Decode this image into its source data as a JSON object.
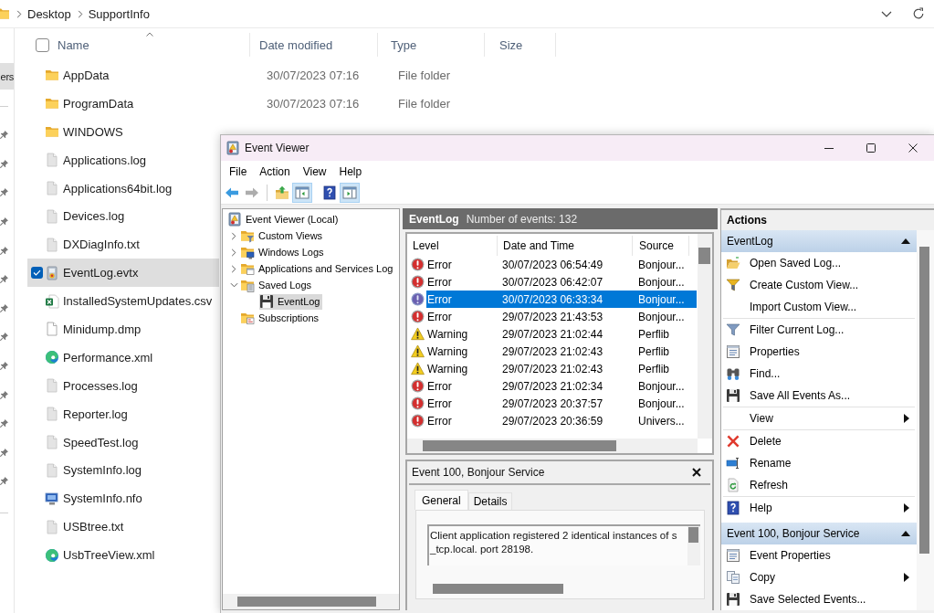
{
  "explorer": {
    "breadcrumb": [
      {
        "label": "Desktop"
      },
      {
        "label": "SupportInfo"
      }
    ],
    "nav_pane": {
      "groups": [
        {
          "items": [
            {
              "label": "ers",
              "selected": true,
              "pinned": false
            }
          ]
        },
        {
          "items": [
            {
              "pinned": true,
              "selected": false
            },
            {
              "pinned": true,
              "selected": false
            },
            {
              "pinned": true,
              "selected": false
            },
            {
              "pinned": true,
              "selected": false
            },
            {
              "pinned": true,
              "selected": false
            },
            {
              "pinned": true,
              "selected": false
            },
            {
              "pinned": true,
              "selected": false
            },
            {
              "pinned": true,
              "selected": false
            },
            {
              "pinned": true,
              "selected": false
            },
            {
              "pinned": true,
              "selected": false
            },
            {
              "pinned": true,
              "selected": false
            },
            {
              "pinned": true,
              "selected": false
            },
            {
              "pinned": true,
              "selected": false
            }
          ]
        }
      ]
    },
    "select_all": {
      "checked": false
    },
    "columns": [
      {
        "label": "Name",
        "sorted": true
      },
      {
        "label": "Date modified",
        "sorted": false
      },
      {
        "label": "Type",
        "sorted": false
      },
      {
        "label": "Size",
        "sorted": false
      }
    ],
    "files": [
      {
        "name": "AppData",
        "kind": "folder",
        "date": "30/07/2023 07:16",
        "type": "File folder",
        "selected": false
      },
      {
        "name": "ProgramData",
        "kind": "folder",
        "date": "30/07/2023 07:16",
        "type": "File folder",
        "selected": false
      },
      {
        "name": "WINDOWS",
        "kind": "folder",
        "selected": false
      },
      {
        "name": "Applications.log",
        "kind": "document",
        "selected": false
      },
      {
        "name": "Applications64bit.log",
        "kind": "document",
        "selected": false
      },
      {
        "name": "Devices.log",
        "kind": "document",
        "selected": false
      },
      {
        "name": "DXDiagInfo.txt",
        "kind": "document",
        "selected": false
      },
      {
        "name": "EventLog.evtx",
        "kind": "event-log",
        "selected": true
      },
      {
        "name": "InstalledSystemUpdates.csv",
        "kind": "spreadsheet",
        "selected": false
      },
      {
        "name": "Minidump.dmp",
        "kind": "blank",
        "selected": false
      },
      {
        "name": "Performance.xml",
        "kind": "web",
        "selected": false
      },
      {
        "name": "Processes.log",
        "kind": "document",
        "selected": false
      },
      {
        "name": "Reporter.log",
        "kind": "document",
        "selected": false
      },
      {
        "name": "SpeedTest.log",
        "kind": "document",
        "selected": false
      },
      {
        "name": "SystemInfo.log",
        "kind": "document",
        "selected": false
      },
      {
        "name": "SystemInfo.nfo",
        "kind": "system-info",
        "selected": false
      },
      {
        "name": "USBtree.txt",
        "kind": "document",
        "selected": false
      },
      {
        "name": "UsbTreeView.xml",
        "kind": "web",
        "selected": false
      }
    ]
  },
  "event_viewer": {
    "title": "Event Viewer",
    "menu": [
      {
        "label": "File"
      },
      {
        "label": "Action"
      },
      {
        "label": "View"
      },
      {
        "label": "Help"
      }
    ],
    "toolbar": [
      {
        "kind": "back",
        "pressed": false,
        "disabled": false
      },
      {
        "kind": "forward",
        "pressed": false,
        "disabled": true
      },
      {
        "kind": "separator"
      },
      {
        "kind": "up",
        "pressed": false,
        "disabled": false
      },
      {
        "kind": "console-tree",
        "pressed": true,
        "disabled": false
      },
      {
        "kind": "help",
        "pressed": false,
        "disabled": false
      },
      {
        "kind": "action-pane",
        "pressed": true,
        "disabled": false
      }
    ],
    "tree": [
      {
        "label": "Event Viewer (Local)",
        "kind": "root",
        "selected": false,
        "children": [
          {
            "label": "Custom Views",
            "kind": "custom-views",
            "expanded": false,
            "selected": false
          },
          {
            "label": "Windows Logs",
            "kind": "windows-logs",
            "expanded": false,
            "selected": false
          },
          {
            "label": "Applications and Services Log",
            "kind": "app-logs",
            "expanded": false,
            "selected": false
          },
          {
            "label": "Saved Logs",
            "kind": "saved-logs",
            "expanded": true,
            "selected": false,
            "children": [
              {
                "label": "EventLog",
                "kind": "saved-log",
                "selected": true
              }
            ]
          },
          {
            "label": "Subscriptions",
            "kind": "subscriptions",
            "selected": false
          }
        ]
      }
    ],
    "log_header": {
      "title": "EventLog",
      "count": "Number of events: 132"
    },
    "events": {
      "columns": [
        {
          "label": "Level"
        },
        {
          "label": "Date and Time"
        },
        {
          "label": "Source"
        }
      ],
      "rows": [
        {
          "kind": "error",
          "level": "Error",
          "date": "30/07/2023 06:54:49",
          "source": "Bonjour...",
          "selected": false
        },
        {
          "kind": "error",
          "level": "Error",
          "date": "30/07/2023 06:42:07",
          "source": "Bonjour...",
          "selected": false
        },
        {
          "kind": "error",
          "level": "Error",
          "date": "30/07/2023 06:33:34",
          "source": "Bonjour...",
          "selected": true
        },
        {
          "kind": "error",
          "level": "Error",
          "date": "29/07/2023 21:43:53",
          "source": "Bonjour...",
          "selected": false
        },
        {
          "kind": "warning",
          "level": "Warning",
          "date": "29/07/2023 21:02:44",
          "source": "Perflib",
          "selected": false
        },
        {
          "kind": "warning",
          "level": "Warning",
          "date": "29/07/2023 21:02:43",
          "source": "Perflib",
          "selected": false
        },
        {
          "kind": "warning",
          "level": "Warning",
          "date": "29/07/2023 21:02:43",
          "source": "Perflib",
          "selected": false
        },
        {
          "kind": "error",
          "level": "Error",
          "date": "29/07/2023 21:02:34",
          "source": "Bonjour...",
          "selected": false
        },
        {
          "kind": "error",
          "level": "Error",
          "date": "29/07/2023 20:37:57",
          "source": "Bonjour...",
          "selected": false
        },
        {
          "kind": "error",
          "level": "Error",
          "date": "29/07/2023 20:36:59",
          "source": "Univers...",
          "selected": false
        }
      ]
    },
    "details": {
      "title": "Event 100, Bonjour Service",
      "tabs": [
        {
          "label": "General",
          "selected": true
        },
        {
          "label": "Details",
          "selected": false
        }
      ],
      "description": "Client application registered 2 identical instances of s\n_tcp.local. port 28198."
    },
    "actions": {
      "title": "Actions",
      "sections": [
        {
          "title": "EventLog",
          "expanded": true,
          "groups": [
            {
              "items": [
                {
                  "label": "Open Saved Log...",
                  "kind": "open-folder",
                  "submenu": false
                },
                {
                  "label": "Create Custom View...",
                  "kind": "create-view",
                  "submenu": false
                },
                {
                  "label": "Import Custom View...",
                  "kind": "plain",
                  "submenu": false
                }
              ]
            },
            {
              "items": [
                {
                  "label": "Filter Current Log...",
                  "kind": "filter",
                  "submenu": false
                },
                {
                  "label": "Properties",
                  "kind": "properties",
                  "submenu": false
                },
                {
                  "label": "Find...",
                  "kind": "find",
                  "submenu": false
                },
                {
                  "label": "Save All Events As...",
                  "kind": "save",
                  "submenu": false
                }
              ]
            },
            {
              "items": [
                {
                  "label": "View",
                  "kind": "plain",
                  "submenu": true
                }
              ]
            },
            {
              "items": [
                {
                  "label": "Delete",
                  "kind": "delete",
                  "submenu": false
                },
                {
                  "label": "Rename",
                  "kind": "rename",
                  "submenu": false
                },
                {
                  "label": "Refresh",
                  "kind": "refresh",
                  "submenu": false
                }
              ]
            },
            {
              "items": [
                {
                  "label": "Help",
                  "kind": "help",
                  "submenu": true
                }
              ]
            }
          ]
        },
        {
          "title": "Event 100, Bonjour Service",
          "expanded": true,
          "groups": [
            {
              "items": [
                {
                  "label": "Event Properties",
                  "kind": "properties",
                  "submenu": false
                },
                {
                  "label": "Copy",
                  "kind": "copy",
                  "submenu": true
                },
                {
                  "label": "Save Selected Events...",
                  "kind": "save",
                  "submenu": false
                }
              ]
            }
          ]
        }
      ]
    }
  }
}
